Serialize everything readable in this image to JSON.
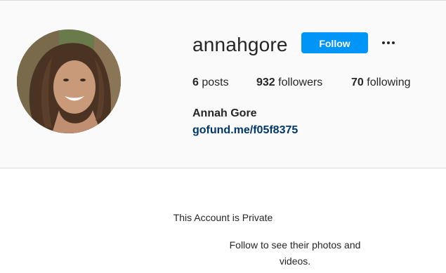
{
  "profile": {
    "username": "annahgore",
    "follow_label": "Follow",
    "more_label": "More options",
    "stats": {
      "posts_count": "6",
      "posts_label": "posts",
      "followers_count": "932",
      "followers_label": "followers",
      "following_count": "70",
      "following_label": "following"
    },
    "full_name": "Annah Gore",
    "link": "gofund.me/f05f8375"
  },
  "private_notice": {
    "title": "This Account is Private",
    "subtitle": "Follow to see their photos and videos."
  },
  "colors": {
    "accent": "#0095f6",
    "link": "#00376b",
    "header_bg": "#fafafa"
  },
  "icons": {
    "more": "more-horizontal-icon"
  }
}
